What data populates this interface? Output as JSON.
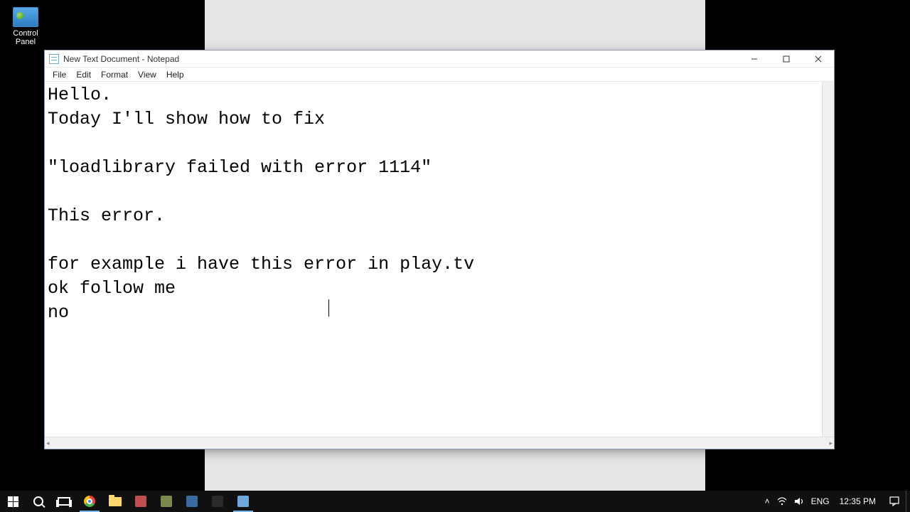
{
  "desktop": {
    "icon_label_line1": "Control",
    "icon_label_line2": "Panel"
  },
  "window": {
    "title": "New Text Document - Notepad",
    "menu": {
      "file": "File",
      "edit": "Edit",
      "format": "Format",
      "view": "View",
      "help": "Help"
    },
    "content": "Hello.\nToday I'll show how to fix\n\n\"loadlibrary failed with error 1114\"\n\nThis error.\n\nfor example i have this error in play.tv\nok follow me\nno"
  },
  "taskbar": {
    "lang": "ENG",
    "time": "12:35 PM"
  }
}
